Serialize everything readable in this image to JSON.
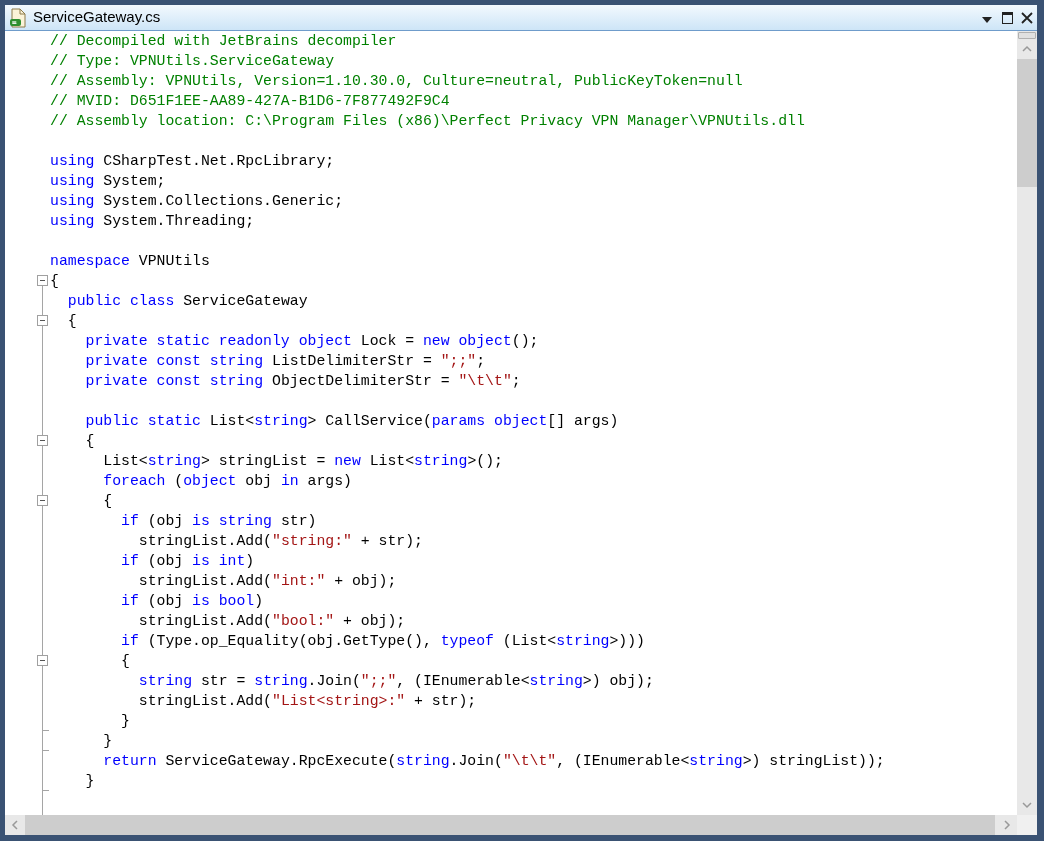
{
  "window": {
    "title": "ServiceGateway.cs"
  },
  "lines": [
    {
      "kind": "code",
      "tokens": [
        {
          "kind": "comment",
          "text": "// Decompiled with JetBrains decompiler"
        }
      ]
    },
    {
      "kind": "code",
      "tokens": [
        {
          "kind": "comment",
          "text": "// Type: VPNUtils.ServiceGateway"
        }
      ]
    },
    {
      "kind": "code",
      "tokens": [
        {
          "kind": "comment",
          "text": "// Assembly: VPNUtils, Version=1.10.30.0, Culture=neutral, PublicKeyToken=null"
        }
      ]
    },
    {
      "kind": "code",
      "tokens": [
        {
          "kind": "comment",
          "text": "// MVID: D651F1EE-AA89-427A-B1D6-7F877492F9C4"
        }
      ]
    },
    {
      "kind": "code",
      "tokens": [
        {
          "kind": "comment",
          "text": "// Assembly location: C:\\Program Files (x86)\\Perfect Privacy VPN Manager\\VPNUtils.dll"
        }
      ]
    },
    {
      "kind": "blank"
    },
    {
      "kind": "code",
      "tokens": [
        {
          "kind": "keyword",
          "text": "using"
        },
        {
          "kind": "plain",
          "text": " CSharpTest.Net.RpcLibrary;"
        }
      ]
    },
    {
      "kind": "code",
      "tokens": [
        {
          "kind": "keyword",
          "text": "using"
        },
        {
          "kind": "plain",
          "text": " System;"
        }
      ]
    },
    {
      "kind": "code",
      "tokens": [
        {
          "kind": "keyword",
          "text": "using"
        },
        {
          "kind": "plain",
          "text": " System.Collections.Generic;"
        }
      ]
    },
    {
      "kind": "code",
      "tokens": [
        {
          "kind": "keyword",
          "text": "using"
        },
        {
          "kind": "plain",
          "text": " System.Threading;"
        }
      ]
    },
    {
      "kind": "blank"
    },
    {
      "kind": "code",
      "tokens": [
        {
          "kind": "keyword",
          "text": "namespace"
        },
        {
          "kind": "plain",
          "text": " VPNUtils"
        }
      ]
    },
    {
      "kind": "collapsible",
      "tokens": [
        {
          "kind": "plain",
          "text": "{"
        }
      ]
    },
    {
      "kind": "code",
      "tokens": [
        {
          "kind": "keyword",
          "text": "  public class"
        },
        {
          "kind": "plain",
          "text": " ServiceGateway"
        }
      ]
    },
    {
      "kind": "collapsible",
      "tokens": [
        {
          "kind": "plain",
          "text": "  {"
        }
      ]
    },
    {
      "kind": "code",
      "tokens": [
        {
          "kind": "keyword",
          "text": "    private static readonly object"
        },
        {
          "kind": "plain",
          "text": " Lock = "
        },
        {
          "kind": "keyword",
          "text": "new object"
        },
        {
          "kind": "plain",
          "text": "();"
        }
      ]
    },
    {
      "kind": "code",
      "tokens": [
        {
          "kind": "keyword",
          "text": "    private const string"
        },
        {
          "kind": "plain",
          "text": " ListDelimiterStr = "
        },
        {
          "kind": "string",
          "text": "\";;\""
        },
        {
          "kind": "plain",
          "text": ";"
        }
      ]
    },
    {
      "kind": "code",
      "tokens": [
        {
          "kind": "keyword",
          "text": "    private const string"
        },
        {
          "kind": "plain",
          "text": " ObjectDelimiterStr = "
        },
        {
          "kind": "string",
          "text": "\"\\t\\t\""
        },
        {
          "kind": "plain",
          "text": ";"
        }
      ]
    },
    {
      "kind": "blank"
    },
    {
      "kind": "code",
      "tokens": [
        {
          "kind": "keyword",
          "text": "    public static"
        },
        {
          "kind": "plain",
          "text": " List<"
        },
        {
          "kind": "keyword",
          "text": "string"
        },
        {
          "kind": "plain",
          "text": "> CallService("
        },
        {
          "kind": "keyword",
          "text": "params object"
        },
        {
          "kind": "plain",
          "text": "[] args)"
        }
      ]
    },
    {
      "kind": "collapsible",
      "tokens": [
        {
          "kind": "plain",
          "text": "    {"
        }
      ]
    },
    {
      "kind": "code",
      "tokens": [
        {
          "kind": "plain",
          "text": "      List<"
        },
        {
          "kind": "keyword",
          "text": "string"
        },
        {
          "kind": "plain",
          "text": "> stringList = "
        },
        {
          "kind": "keyword",
          "text": "new"
        },
        {
          "kind": "plain",
          "text": " List<"
        },
        {
          "kind": "keyword",
          "text": "string"
        },
        {
          "kind": "plain",
          "text": ">();"
        }
      ]
    },
    {
      "kind": "code",
      "tokens": [
        {
          "kind": "keyword",
          "text": "      foreach"
        },
        {
          "kind": "plain",
          "text": " ("
        },
        {
          "kind": "keyword",
          "text": "object"
        },
        {
          "kind": "plain",
          "text": " obj "
        },
        {
          "kind": "keyword",
          "text": "in"
        },
        {
          "kind": "plain",
          "text": " args)"
        }
      ]
    },
    {
      "kind": "collapsible",
      "tokens": [
        {
          "kind": "plain",
          "text": "      {"
        }
      ]
    },
    {
      "kind": "code",
      "tokens": [
        {
          "kind": "keyword",
          "text": "        if"
        },
        {
          "kind": "plain",
          "text": " (obj "
        },
        {
          "kind": "keyword",
          "text": "is string"
        },
        {
          "kind": "plain",
          "text": " str)"
        }
      ]
    },
    {
      "kind": "code",
      "tokens": [
        {
          "kind": "plain",
          "text": "          stringList.Add("
        },
        {
          "kind": "string",
          "text": "\"string:\""
        },
        {
          "kind": "plain",
          "text": " + str);"
        }
      ]
    },
    {
      "kind": "code",
      "tokens": [
        {
          "kind": "keyword",
          "text": "        if"
        },
        {
          "kind": "plain",
          "text": " (obj "
        },
        {
          "kind": "keyword",
          "text": "is int"
        },
        {
          "kind": "plain",
          "text": ")"
        }
      ]
    },
    {
      "kind": "code",
      "tokens": [
        {
          "kind": "plain",
          "text": "          stringList.Add("
        },
        {
          "kind": "string",
          "text": "\"int:\""
        },
        {
          "kind": "plain",
          "text": " + obj);"
        }
      ]
    },
    {
      "kind": "code",
      "tokens": [
        {
          "kind": "keyword",
          "text": "        if"
        },
        {
          "kind": "plain",
          "text": " (obj "
        },
        {
          "kind": "keyword",
          "text": "is bool"
        },
        {
          "kind": "plain",
          "text": ")"
        }
      ]
    },
    {
      "kind": "code",
      "tokens": [
        {
          "kind": "plain",
          "text": "          stringList.Add("
        },
        {
          "kind": "string",
          "text": "\"bool:\""
        },
        {
          "kind": "plain",
          "text": " + obj);"
        }
      ]
    },
    {
      "kind": "code",
      "tokens": [
        {
          "kind": "keyword",
          "text": "        if"
        },
        {
          "kind": "plain",
          "text": " (Type.op_Equality(obj.GetType(), "
        },
        {
          "kind": "keyword",
          "text": "typeof"
        },
        {
          "kind": "plain",
          "text": " (List<"
        },
        {
          "kind": "keyword",
          "text": "string"
        },
        {
          "kind": "plain",
          "text": ">)))"
        }
      ]
    },
    {
      "kind": "collapsible",
      "tokens": [
        {
          "kind": "plain",
          "text": "        {"
        }
      ]
    },
    {
      "kind": "code",
      "tokens": [
        {
          "kind": "keyword",
          "text": "          string"
        },
        {
          "kind": "plain",
          "text": " str = "
        },
        {
          "kind": "keyword",
          "text": "string"
        },
        {
          "kind": "plain",
          "text": ".Join("
        },
        {
          "kind": "string",
          "text": "\";;\""
        },
        {
          "kind": "plain",
          "text": ", (IEnumerable<"
        },
        {
          "kind": "keyword",
          "text": "string"
        },
        {
          "kind": "plain",
          "text": ">) obj);"
        }
      ]
    },
    {
      "kind": "code",
      "tokens": [
        {
          "kind": "plain",
          "text": "          stringList.Add("
        },
        {
          "kind": "string",
          "text": "\"List<string>:\""
        },
        {
          "kind": "plain",
          "text": " + str);"
        }
      ]
    },
    {
      "kind": "blockend",
      "tokens": [
        {
          "kind": "plain",
          "text": "        }"
        }
      ]
    },
    {
      "kind": "blockend",
      "tokens": [
        {
          "kind": "plain",
          "text": "      }"
        }
      ]
    },
    {
      "kind": "code",
      "tokens": [
        {
          "kind": "keyword",
          "text": "      return"
        },
        {
          "kind": "plain",
          "text": " ServiceGateway.RpcExecute("
        },
        {
          "kind": "keyword",
          "text": "string"
        },
        {
          "kind": "plain",
          "text": ".Join("
        },
        {
          "kind": "string",
          "text": "\"\\t\\t\""
        },
        {
          "kind": "plain",
          "text": ", (IEnumerable<"
        },
        {
          "kind": "keyword",
          "text": "string"
        },
        {
          "kind": "plain",
          "text": ">) stringList));"
        }
      ]
    },
    {
      "kind": "blockend",
      "tokens": [
        {
          "kind": "plain",
          "text": "    }"
        }
      ]
    }
  ]
}
